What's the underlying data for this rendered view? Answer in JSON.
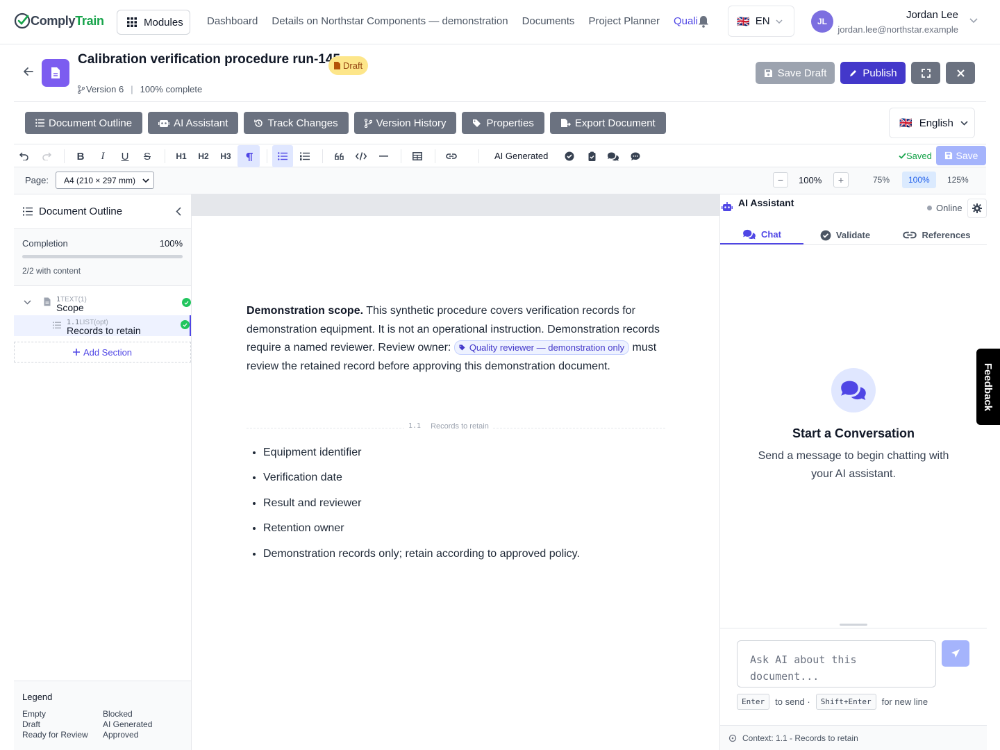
{
  "app": {
    "logo_part1": "Comply",
    "logo_part2": "Train"
  },
  "topbar": {
    "modules_label": "Modules",
    "nav": [
      {
        "label": "Dashboard"
      },
      {
        "label": "Details on Northstar Components — demonstration"
      },
      {
        "label": "Documents"
      },
      {
        "label": "Project Planner"
      },
      {
        "label": "Quali",
        "active": true
      }
    ],
    "language": {
      "flag": "🇬🇧",
      "code": "EN"
    },
    "user": {
      "initials": "JL",
      "name": "Jordan Lee",
      "email": "jordan.lee@northstar.example"
    }
  },
  "document": {
    "title": "Calibration verification procedure run-145",
    "status": "Draft",
    "version": "Version 6",
    "completion_text": "100% complete",
    "actions": {
      "save_draft": "Save Draft",
      "publish": "Publish"
    }
  },
  "toolbar": {
    "buttons": [
      {
        "label": "Document Outline",
        "icon": "list-icon"
      },
      {
        "label": "AI Assistant",
        "icon": "robot-icon"
      },
      {
        "label": "Track Changes",
        "icon": "history-icon"
      },
      {
        "label": "Version History",
        "icon": "branch-icon"
      },
      {
        "label": "Properties",
        "icon": "tags-icon"
      },
      {
        "label": "Export Document",
        "icon": "export-icon"
      }
    ],
    "language": {
      "flag": "🇬🇧",
      "label": "English"
    }
  },
  "editor_toolbar": {
    "h1": "H1",
    "h2": "H2",
    "h3": "H3",
    "ai_generated": "AI Generated",
    "saved": "Saved",
    "save": "Save"
  },
  "page_bar": {
    "page_label": "Page:",
    "page_size": "A4 (210 × 297 mm)",
    "zoom": "100%",
    "presets": [
      "75%",
      "100%",
      "125%"
    ],
    "active_preset": "100%"
  },
  "outline": {
    "title": "Document Outline",
    "completion_label": "Completion",
    "completion_value": "100%",
    "completion_fraction": 1.0,
    "content_count": "2/2 with content",
    "sections": [
      {
        "number": "1",
        "type": "TEXT(1)",
        "name": "Scope"
      },
      {
        "number": "1.1",
        "type": "LIST(opt)",
        "name": "Records to retain"
      }
    ],
    "add_section": "Add Section",
    "legend_title": "Legend",
    "legend": [
      "Empty",
      "Blocked",
      "Draft",
      "AI Generated",
      "Ready for Review",
      "Approved"
    ]
  },
  "content": {
    "scope_lead": "Demonstration scope.",
    "scope_text": " This synthetic procedure covers verification records for demonstration equipment. It is not an operational instruction. Demonstration records require a named reviewer. Review owner: ",
    "chip_label": "Quality reviewer — demonstration only",
    "scope_tail": " must review the retained record before ap­proving this demonstration document.",
    "section_number": "1.1",
    "section_name": "Records to retain",
    "bullets": [
      "Equipment identifier",
      "Verification date",
      "Result and reviewer",
      "Retention owner",
      "Demonstration records only; retain according to approved policy."
    ]
  },
  "assistant": {
    "title": "AI Assistant",
    "status": "Online",
    "tabs": [
      "Chat",
      "Validate",
      "References"
    ],
    "active_tab": "Chat",
    "empty_title": "Start a Conversation",
    "empty_subtitle": "Send a message to begin chatting with your AI assistant.",
    "input_placeholder": "Ask AI about this document...",
    "hint_enter": "Enter",
    "hint_send": "to send ·",
    "hint_shift": "Shift+Enter",
    "hint_newline": "for new line",
    "context": "Context: 1.1 - Records to retain"
  },
  "feedback": "Feedback",
  "colors": {
    "accent": "#4f46e5",
    "success": "#22c55e",
    "brand_green": "#16a34a"
  }
}
